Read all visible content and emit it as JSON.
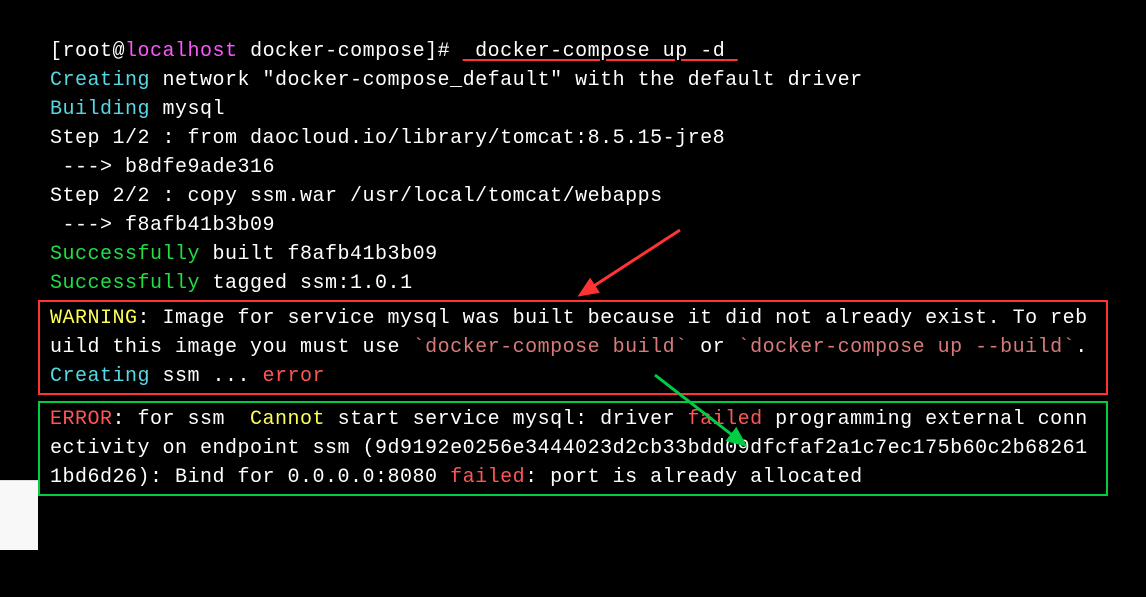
{
  "prompt": {
    "user": "root",
    "host": "localhost",
    "dir": "docker-compose",
    "symbol": "]# ",
    "command_prefix": " ",
    "command": "docker-compose up -d",
    "trailing": " "
  },
  "lines": {
    "l1_creating": "Creating",
    "l1_rest": " network \"docker-compose_default\" with the default driver",
    "l2_building": "Building",
    "l2_rest": " mysql",
    "l3": "Step 1/2 : from daocloud.io/library/tomcat:8.5.15-jre8",
    "l4": " ---> b8dfe9ade316",
    "l5": "Step 2/2 : copy ssm.war /usr/local/tomcat/webapps",
    "l6": " ---> f8afb41b3b09",
    "l7_success": "Successfully",
    "l7_rest": " built f8afb41b3b09",
    "l8_success": "Successfully",
    "l8_rest": " tagged ssm:1.0.1"
  },
  "warning_box": {
    "warning_label": "WARNING",
    "warning_text_1": ": Image for service mysql was built because it did not already exist. To rebuild this image you must use ",
    "code1": "`docker-compose build`",
    "warning_text_2": " or ",
    "code2": "`docker-compose up --build`",
    "warning_text_3": ".",
    "creating": "Creating",
    "ssm_text": " ssm ... ",
    "error_word": "error"
  },
  "error_box": {
    "error_label": "ERROR",
    "colon_for": ": for ssm  ",
    "cannot": "Cannot",
    "text1": " start service mysql: driver ",
    "failed1": "failed",
    "text2": " programming external connectivity on endpoint ssm (9d9192e0256e3444023d2cb33bdd09dfcfaf2a1c7ec175b60c2b682611bd6d26): Bind for 0.0.0.0:8080 ",
    "failed2": "failed",
    "text3": ": port is already allocated"
  }
}
